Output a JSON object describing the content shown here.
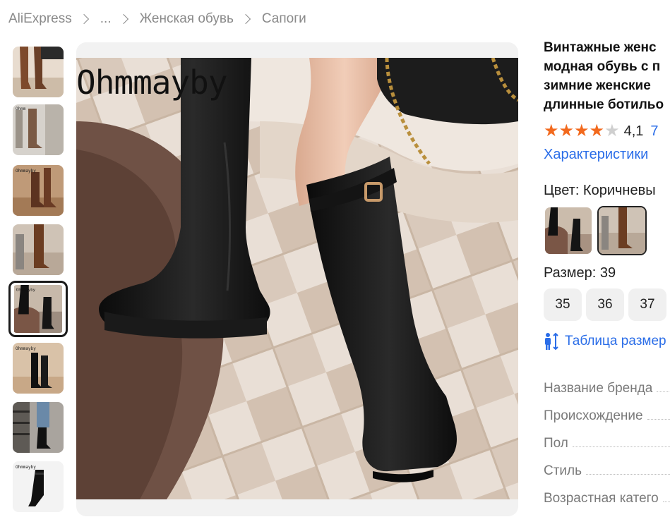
{
  "breadcrumb": {
    "items": [
      "AliExpress",
      "...",
      "Женская обувь",
      "Сапоги"
    ]
  },
  "gallery": {
    "watermark_main": "Ohmmayby",
    "watermark_thumb": "Ohmmayby",
    "active_index": 4,
    "thumbnail_count": 8
  },
  "product": {
    "title_lines": [
      "Винтажные женс",
      "модная обувь с п",
      "зимние женские",
      "длинные ботильо"
    ],
    "rating": {
      "stars_filled": 4,
      "stars_total": 5,
      "value": "4,1",
      "reviews_link": "7"
    },
    "specs_link": "Характеристики",
    "color": {
      "label": "Цвет: Коричневы"
    },
    "size": {
      "label": "Размер: 39",
      "options": [
        "35",
        "36",
        "37"
      ]
    },
    "size_table_link": "Таблица размер",
    "properties": [
      {
        "name": "Название бренда"
      },
      {
        "name": "Происхождение"
      },
      {
        "name": "Пол"
      },
      {
        "name": "Стиль"
      },
      {
        "name": "Возрастная катего"
      }
    ]
  },
  "colors": {
    "star": "#f2691d",
    "link": "#2a6de8"
  }
}
